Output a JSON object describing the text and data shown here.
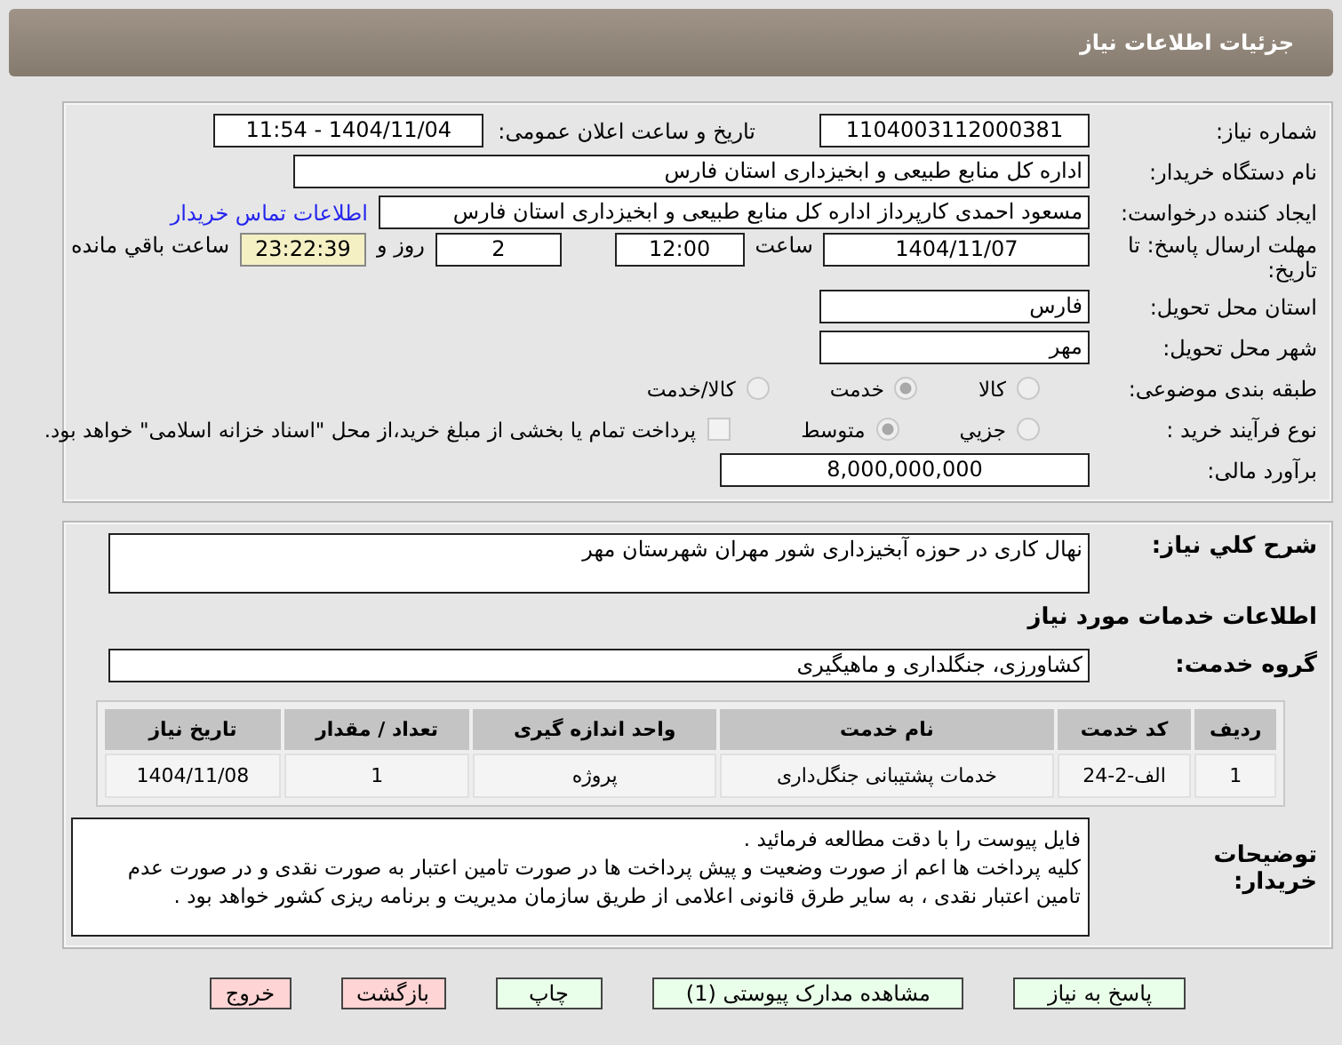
{
  "header": {
    "title": "جزئیات اطلاعات نیاز"
  },
  "need_number": {
    "label": "شماره نیاز:",
    "value": "1104003112000381"
  },
  "announce_date": {
    "label": "تاریخ و ساعت اعلان عمومی:",
    "value": "1404/11/04 - 11:54"
  },
  "buyer": {
    "label": "نام دستگاه خریدار:",
    "value": "اداره کل منابع طبیعی و ابخیزداری استان فارس"
  },
  "requester": {
    "label": "ایجاد کننده درخواست:",
    "value": "مسعود احمدی کارپرداز اداره کل منابع طبیعی و ابخیزداری استان فارس",
    "link": "اطلاعات تماس خریدار"
  },
  "deadline": {
    "label": "مهلت ارسال پاسخ: تا تاریخ:",
    "date": "1404/11/07",
    "time_label": "ساعت",
    "time": "12:00",
    "days": "2",
    "days_label": "روز و",
    "remaining": "23:22:39",
    "remaining_label": "ساعت باقي مانده"
  },
  "province": {
    "label": "استان محل تحویل:",
    "value": "فارس"
  },
  "city": {
    "label": "شهر محل تحویل:",
    "value": "مهر"
  },
  "category": {
    "label": "طبقه بندی موضوعی:",
    "options": [
      {
        "label": "کالا",
        "selected": false
      },
      {
        "label": "خدمت",
        "selected": true
      },
      {
        "label": "کالا/خدمت",
        "selected": false
      }
    ]
  },
  "process": {
    "label": "نوع فرآیند خرید :",
    "options": [
      {
        "label": "جزيي",
        "selected": false
      },
      {
        "label": "متوسط",
        "selected": true
      }
    ],
    "treasury": {
      "checked": false,
      "label": "پرداخت تمام یا بخشی از مبلغ خرید،از محل \"اسناد خزانه اسلامی\" خواهد بود."
    }
  },
  "budget": {
    "label": "برآورد مالی:",
    "value": "8,000,000,000"
  },
  "summary": {
    "label": "شرح کلي نیاز:",
    "value": "نهال کاری در حوزه آبخیزداری شور مهران شهرستان مهر"
  },
  "services_heading": "اطلاعات خدمات مورد نیاز",
  "service_group": {
    "label": "گروه خدمت:",
    "value": "کشاورزی، جنگلداری و ماهیگیری"
  },
  "table": {
    "columns": [
      "ردیف",
      "کد خدمت",
      "نام خدمت",
      "واحد اندازه گیری",
      "تعداد / مقدار",
      "تاریخ نیاز"
    ],
    "rows": [
      [
        "1",
        "الف-2-24",
        "خدمات پشتیبانی جنگل‌داری",
        "پروژه",
        "1",
        "1404/11/08"
      ]
    ]
  },
  "notes": {
    "label": "توضیحات خریدار:",
    "paragraphs": [
      "فایل پیوست را با دقت مطالعه فرمائید .",
      "کلیه پرداخت ها  اعم از صورت وضعیت و پیش پرداخت ها در صورت تامین اعتبار به صورت نقدی و در صورت عدم تامین اعتبار نقدی ، به سایر طرق قانونی اعلامی از طریق سازمان مدیریت و برنامه ریزی کشور خواهد بود ."
    ]
  },
  "buttons": [
    {
      "label": "پاسخ به نیاز",
      "kind": "action"
    },
    {
      "label": "مشاهده مدارک پیوستی (1)",
      "kind": "action"
    },
    {
      "label": "چاپ",
      "kind": "action"
    },
    {
      "label": "بازگشت",
      "kind": "exit"
    },
    {
      "label": "خروج",
      "kind": "exit"
    }
  ]
}
